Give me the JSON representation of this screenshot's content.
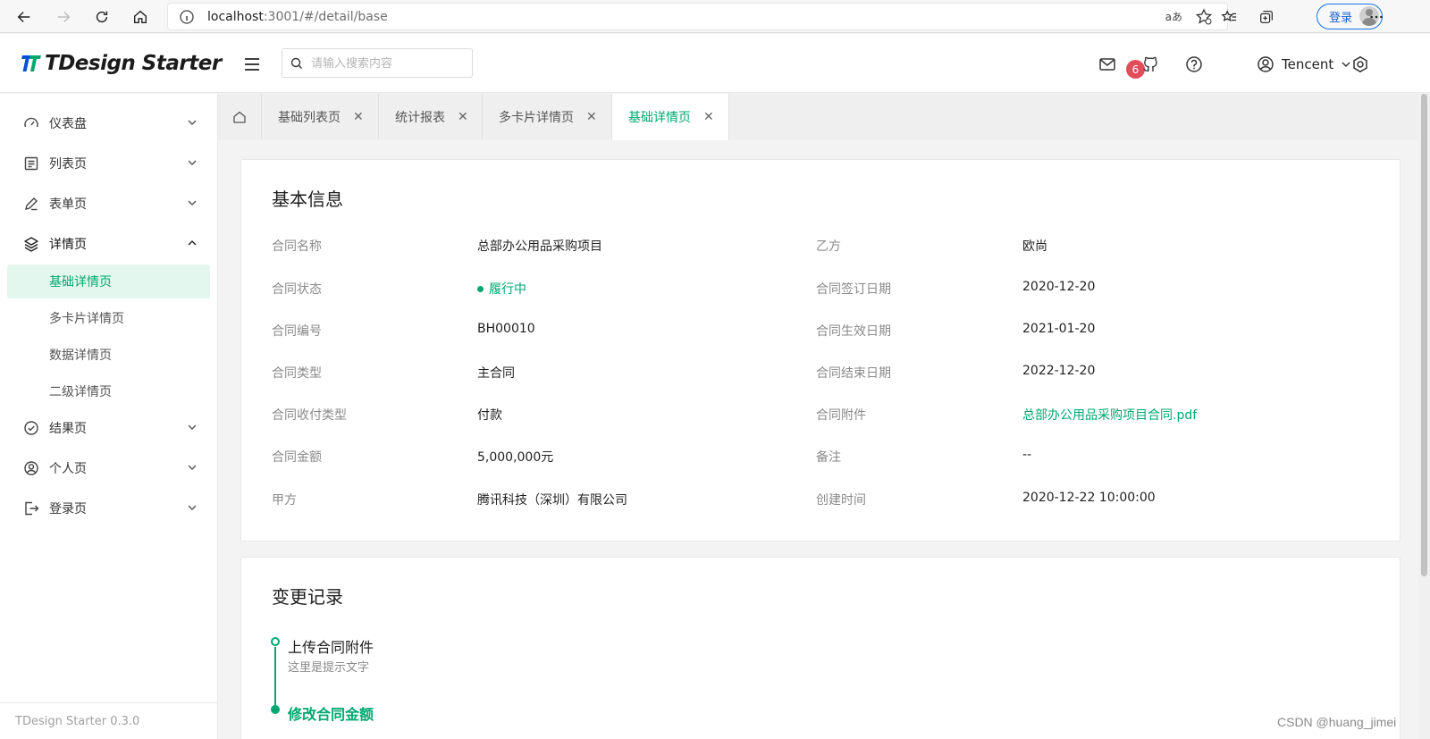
{
  "browser": {
    "url_host": "localhost",
    "url_path": ":3001/#/detail/base",
    "translate_glyph": "aあ",
    "login_label": "登录"
  },
  "header": {
    "logo_text": "TDesign Starter",
    "search_placeholder": "请输入搜索内容",
    "notification_count": "6",
    "user_name": "Tencent"
  },
  "sidebar": {
    "items": [
      {
        "label": "仪表盘",
        "icon": "dashboard-icon"
      },
      {
        "label": "列表页",
        "icon": "list-icon"
      },
      {
        "label": "表单页",
        "icon": "edit-icon"
      },
      {
        "label": "详情页",
        "icon": "layers-icon"
      },
      {
        "label": "结果页",
        "icon": "check-circle-icon"
      },
      {
        "label": "个人页",
        "icon": "user-circle-icon"
      },
      {
        "label": "登录页",
        "icon": "logout-icon"
      }
    ],
    "sub_items": [
      "基础详情页",
      "多卡片详情页",
      "数据详情页",
      "二级详情页"
    ],
    "footer": "TDesign Starter 0.3.0"
  },
  "tabs": [
    "基础列表页",
    "统计报表",
    "多卡片详情页",
    "基础详情页"
  ],
  "basic_info": {
    "title": "基本信息",
    "left": [
      {
        "label": "合同名称",
        "value": "总部办公用品采购项目"
      },
      {
        "label": "合同状态",
        "value": "履行中"
      },
      {
        "label": "合同编号",
        "value": "BH00010"
      },
      {
        "label": "合同类型",
        "value": "主合同"
      },
      {
        "label": "合同收付类型",
        "value": "付款"
      },
      {
        "label": "合同金额",
        "value": "5,000,000元"
      },
      {
        "label": "甲方",
        "value": "腾讯科技（深圳）有限公司"
      }
    ],
    "right": [
      {
        "label": "乙方",
        "value": "欧尚"
      },
      {
        "label": "合同签订日期",
        "value": "2020-12-20"
      },
      {
        "label": "合同生效日期",
        "value": "2021-01-20"
      },
      {
        "label": "合同结束日期",
        "value": "2022-12-20"
      },
      {
        "label": "合同附件",
        "value": "总部办公用品采购项目合同.pdf"
      },
      {
        "label": "备注",
        "value": "--"
      },
      {
        "label": "创建时间",
        "value": "2020-12-22 10:00:00"
      }
    ]
  },
  "change_log": {
    "title": "变更记录",
    "items": [
      {
        "title": "上传合同附件",
        "desc": "这里是提示文字"
      },
      {
        "title": "修改合同金额"
      }
    ]
  },
  "watermark": "CSDN @huang_jimei",
  "colors": {
    "brand": "#00a870",
    "badge": "#e34d59"
  }
}
